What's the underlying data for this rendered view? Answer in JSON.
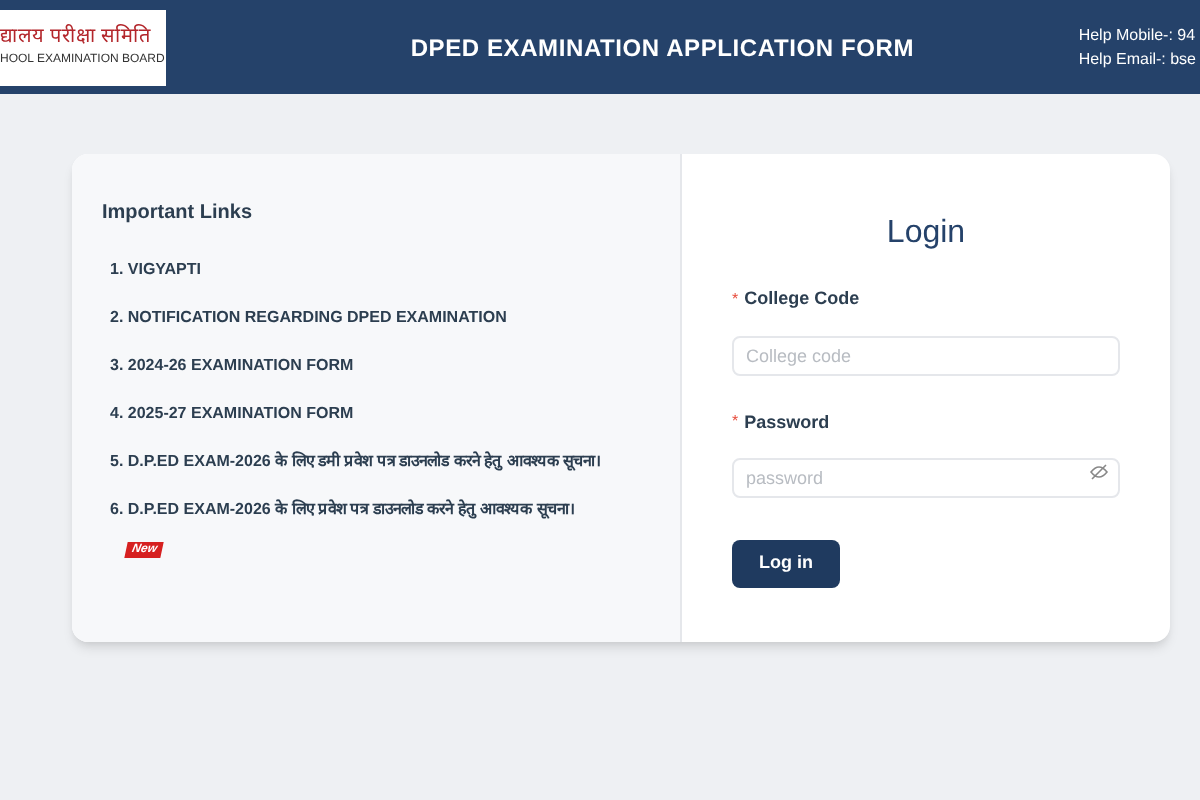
{
  "header": {
    "logo_hindi": "द्यालय परीक्षा समिति",
    "logo_english": "HOOL EXAMINATION BOARD",
    "title": "DPED EXAMINATION APPLICATION FORM",
    "help_mobile": "Help Mobile-: 94",
    "help_email": "Help Email-: bse"
  },
  "important_links": {
    "heading": "Important Links",
    "items": [
      {
        "text": "1. VIGYAPTI",
        "new": false
      },
      {
        "text": "2. NOTIFICATION REGARDING DPED EXAMINATION",
        "new": false
      },
      {
        "text": "3. 2024-26 EXAMINATION FORM",
        "new": false
      },
      {
        "text": "4. 2025-27 EXAMINATION FORM",
        "new": false
      },
      {
        "text": "5. **D.P.ED EXAM-2026** के लिए डमी प्रवेश पत्र डाउनलोड करने हेतु आवश्यक सूचना।",
        "new": false
      },
      {
        "text": "6. **D.P.ED EXAM-2026** के लिए प्रवेश पत्र डाउनलोड करने हेतु आवश्यक सूचना।",
        "new": true,
        "badge": "New"
      }
    ]
  },
  "login": {
    "title": "Login",
    "fields": [
      {
        "label": "College Code",
        "required_mark": "*",
        "placeholder": "College code",
        "kind": "text"
      },
      {
        "label": "Password",
        "required_mark": "*",
        "placeholder": "password",
        "kind": "password"
      }
    ],
    "button": "Log in"
  }
}
